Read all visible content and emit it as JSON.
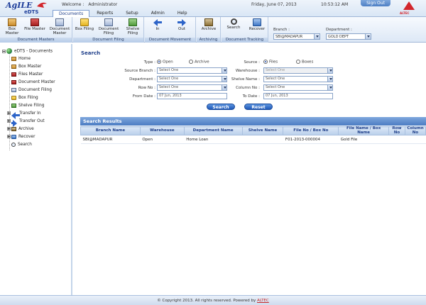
{
  "header": {
    "logo_main": "AgILE",
    "logo_sub": "eDTS",
    "welcome_label": "Welcome :",
    "user_name": "Administrator",
    "date": "Friday, June 07, 2013",
    "time": "10:53:12 AM",
    "sign_out": "Sign Out",
    "brand": "ALTEC"
  },
  "menu": [
    "Documents",
    "Reports",
    "Setup",
    "Admin",
    "Help"
  ],
  "toolbar": {
    "groups": [
      {
        "label": "Document Masters",
        "buttons": [
          "Box Master",
          "File Master",
          "Document Master"
        ]
      },
      {
        "label": "Document Filing",
        "buttons": [
          "Box Filing",
          "Document Filing",
          "Shelve Filing"
        ]
      },
      {
        "label": "Document Movement",
        "buttons": [
          "In",
          "Out"
        ]
      },
      {
        "label": "Archiving",
        "buttons": [
          "Archive"
        ]
      },
      {
        "label": "Document Tracking",
        "buttons": [
          "Search",
          "Recover"
        ]
      }
    ],
    "branch_label": "Branch :",
    "branch_value": "SBI@MADAPUR",
    "department_label": "Department :",
    "department_value": "GOLD DEPT"
  },
  "sidebar": {
    "root": "eDTS - Documents",
    "items": [
      "Home",
      "Box Master",
      "Files Master",
      "Document Master",
      "Document Filing",
      "Box Filing",
      "Shelve Filing",
      "Transfer In",
      "Transfer Out",
      "Archive",
      "Recover",
      "Search"
    ]
  },
  "search": {
    "title": "Search",
    "type_label": "Type :",
    "type_options": [
      "Open",
      "Archive"
    ],
    "source_label": "Source :",
    "source_options": [
      "Files",
      "Boxes"
    ],
    "source_branch_label": "Source Branch :",
    "source_branch_value": "Select One",
    "warehouse_label": "Warehouse :",
    "warehouse_value": "Select One",
    "department_label": "Department :",
    "department_value": "Select One",
    "shelve_name_label": "Shelve Name :",
    "shelve_name_value": "Select One",
    "row_no_label": "Row No :",
    "row_no_value": "Select One",
    "column_no_label": "Column No :",
    "column_no_value": "Select One",
    "from_date_label": "From Date :",
    "from_date_value": "07 Jun, 2013",
    "to_date_label": "To Date :",
    "to_date_value": "07 Jun, 2013",
    "search_button": "Search",
    "reset_button": "Reset"
  },
  "results": {
    "title": "Search Results",
    "columns": [
      "Branch Name",
      "Warehouse",
      "Department Name",
      "Shelve Name",
      "File No / Box No",
      "File Name / Box Name",
      "Row No",
      "Column No"
    ],
    "rows": [
      [
        "SBI@MADAPUR",
        "Open",
        "Home Loan",
        "",
        "F01-2013-000004",
        "Gold File",
        "",
        ""
      ]
    ]
  },
  "footer": {
    "text": "© Copyright 2013. All rights reserved. Powered by",
    "link": "ALTEC"
  }
}
